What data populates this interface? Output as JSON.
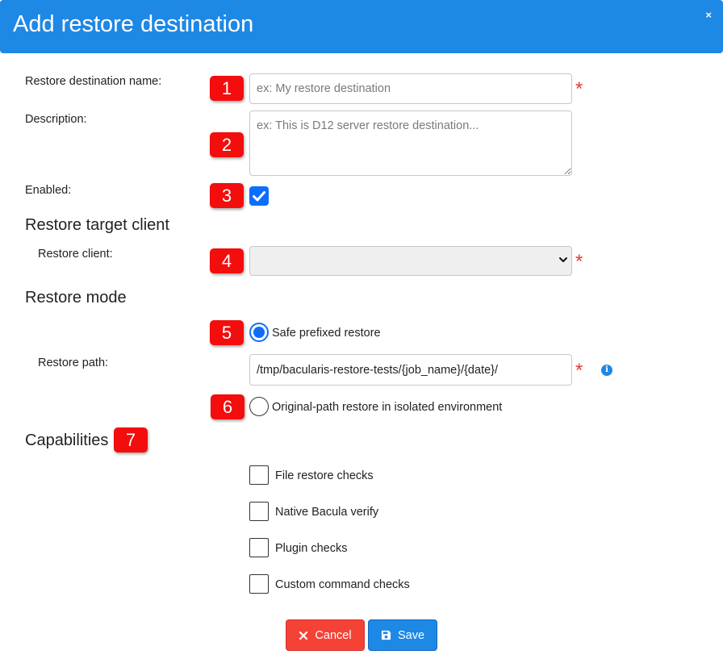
{
  "dialog": {
    "title": "Add restore destination",
    "close_glyph": "×"
  },
  "fields": {
    "name_label": "Restore destination name:",
    "name_placeholder": "ex: My restore destination",
    "description_label": "Description:",
    "description_placeholder": "ex: This is D12 server restore destination...",
    "enabled_label": "Enabled:",
    "enabled_checked": true
  },
  "target_section": {
    "title": "Restore target client",
    "client_label": "Restore client:",
    "client_value": ""
  },
  "mode_section": {
    "title": "Restore mode",
    "option_safe": "Safe prefixed restore",
    "safe_selected": true,
    "path_label": "Restore path:",
    "path_value": "/tmp/bacularis-restore-tests/{job_name}/{date}/",
    "option_original": "Original-path restore in isolated environment"
  },
  "capabilities": {
    "title": "Capabilities",
    "items": [
      "File restore checks",
      "Native Bacula verify",
      "Plugin checks",
      "Custom command checks"
    ]
  },
  "badges": [
    "1",
    "2",
    "3",
    "4",
    "5",
    "6",
    "7"
  ],
  "required_glyph": "*",
  "info_glyph": "i",
  "buttons": {
    "cancel": "Cancel",
    "save": "Save"
  },
  "colors": {
    "header": "#1e88e5",
    "badge": "#f40d0d",
    "required": "#e53935",
    "cancel": "#f44336",
    "save": "#1e88e5"
  }
}
